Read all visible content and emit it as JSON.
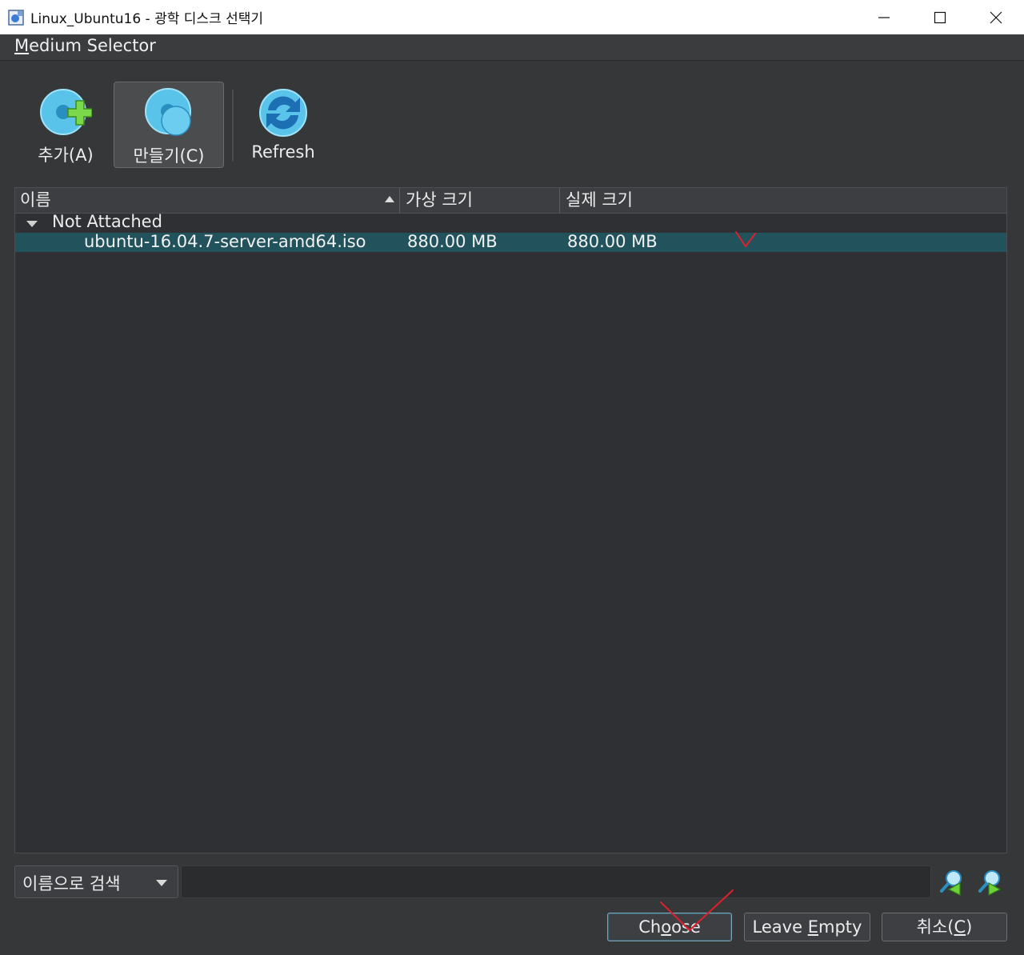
{
  "window": {
    "title": "Linux_Ubuntu16 - 광학 디스크 선택기",
    "minimize_icon": "minimize-icon",
    "maximize_icon": "maximize-icon",
    "close_icon": "close-icon"
  },
  "menu": {
    "medium_selector_mnemonic": "M",
    "medium_selector_rest": "edium Selector"
  },
  "toolbar": {
    "add_label": "추가(A)",
    "create_label": "만들기(C)",
    "refresh_label": "Refresh"
  },
  "table": {
    "columns": [
      "이름",
      "가상 크기",
      "실제 크기"
    ],
    "group": "Not Attached",
    "rows": [
      {
        "name": "ubuntu-16.04.7-server-amd64.iso",
        "virtual_size": "880.00 MB",
        "actual_size": "880.00 MB"
      }
    ]
  },
  "search": {
    "mode": "이름으로 검색",
    "value": "",
    "prev_icon": "search-previous-icon",
    "next_icon": "search-next-icon"
  },
  "buttons": {
    "choose_pre": "Ch",
    "choose_mn": "o",
    "choose_post": "ose",
    "leave_pre": "Leave ",
    "leave_mn": "E",
    "leave_post": "mpty",
    "cancel_pre": "취소(",
    "cancel_mn": "C",
    "cancel_post": ")"
  },
  "colors": {
    "selection": "#22525c",
    "annotation": "#e0202a"
  }
}
